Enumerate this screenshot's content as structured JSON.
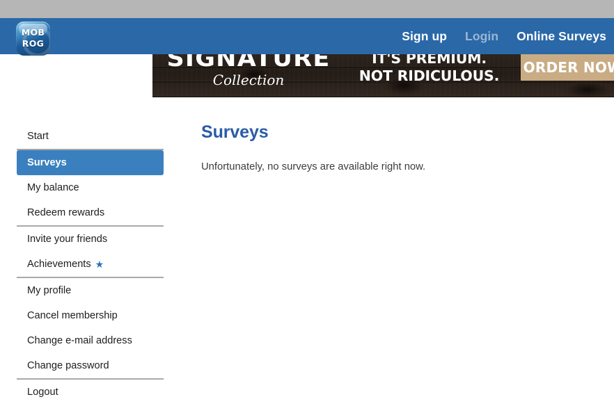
{
  "browser": {
    "chrome_strip_color": "#b6b6b6"
  },
  "header": {
    "background_color": "#2a68a8",
    "logo": {
      "line1": "MOB",
      "line2": "ROG",
      "name": "mobrog-logo"
    },
    "nav": [
      {
        "label": "Sign up",
        "name": "nav-sign-up",
        "muted": false
      },
      {
        "label": "Login",
        "name": "nav-login",
        "muted": true
      },
      {
        "label": "Online Surveys",
        "name": "nav-online-surveys",
        "muted": false
      }
    ]
  },
  "ad_banner": {
    "headline_top": "SIGNATURE",
    "headline_script": "Collection",
    "tagline_line1": "IT'S PREMIUM.",
    "tagline_line2": "NOT RIDICULOUS.",
    "cta_label": "ORDER NOW",
    "cta_color": "#c9ac84"
  },
  "sidebar": {
    "active_color": "#3a80bf",
    "items": [
      {
        "label": "Start",
        "name": "sidebar-item-start",
        "active": false,
        "separator_before": false,
        "star": false
      },
      {
        "label": "Surveys",
        "name": "sidebar-item-surveys",
        "active": true,
        "separator_before": true,
        "star": false
      },
      {
        "label": "My balance",
        "name": "sidebar-item-my-balance",
        "active": false,
        "separator_before": false,
        "star": false
      },
      {
        "label": "Redeem rewards",
        "name": "sidebar-item-redeem-rewards",
        "active": false,
        "separator_before": false,
        "star": false
      },
      {
        "label": "Invite your friends",
        "name": "sidebar-item-invite-friends",
        "active": false,
        "separator_before": true,
        "star": false
      },
      {
        "label": "Achievements",
        "name": "sidebar-item-achievements",
        "active": false,
        "separator_before": false,
        "star": true
      },
      {
        "label": "My profile",
        "name": "sidebar-item-my-profile",
        "active": false,
        "separator_before": true,
        "star": false
      },
      {
        "label": "Cancel membership",
        "name": "sidebar-item-cancel-membership",
        "active": false,
        "separator_before": false,
        "star": false
      },
      {
        "label": "Change e-mail address",
        "name": "sidebar-item-change-email",
        "active": false,
        "separator_before": false,
        "star": false
      },
      {
        "label": "Change password",
        "name": "sidebar-item-change-password",
        "active": false,
        "separator_before": false,
        "star": false
      },
      {
        "label": "Logout",
        "name": "sidebar-item-logout",
        "active": false,
        "separator_before": true,
        "star": false
      }
    ],
    "star_glyph": "★",
    "star_color": "#2a72b8"
  },
  "main": {
    "title": "Surveys",
    "title_color": "#2a5ca8",
    "message": "Unfortunately, no surveys are available right now."
  }
}
